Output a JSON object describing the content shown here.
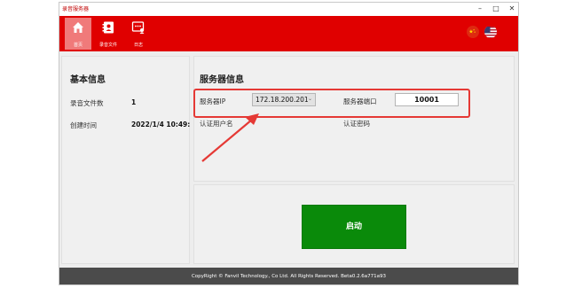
{
  "window": {
    "title": "录音服务器"
  },
  "window_controls": {
    "minimize": "–",
    "maximize": "□",
    "close": "✕"
  },
  "toolbar": {
    "items": [
      {
        "label": "首页",
        "icon": "home-icon"
      },
      {
        "label": "录音文件",
        "icon": "contacts-icon"
      },
      {
        "label": "日志",
        "icon": "log-icon"
      }
    ],
    "languages": [
      {
        "icon": "china-flag-icon"
      },
      {
        "icon": "us-flag-icon"
      }
    ]
  },
  "basic_info": {
    "title": "基本信息",
    "file_count_label": "录音文件数",
    "file_count_value": "1",
    "created_label": "创建时间",
    "created_value": "2022/1/4 10:49:"
  },
  "server_info": {
    "title": "服务器信息",
    "ip_label": "服务器IP",
    "ip_value": "172.18.200.201",
    "port_label": "服务器端口",
    "port_value": "10001",
    "auth_user_label": "认证用户名",
    "auth_pwd_label": "认证密码"
  },
  "actions": {
    "start_label": "启动",
    "start_color": "#0a8a0a"
  },
  "footer": {
    "copyright": "CopyRight © Fanvil Technology., Co Ltd. All Rights Reserved.   Beta0.2.6a771a93"
  },
  "colors": {
    "toolbar": "#e00000",
    "highlight_box": "#e53935",
    "status_bar": "#4b4b4b"
  }
}
